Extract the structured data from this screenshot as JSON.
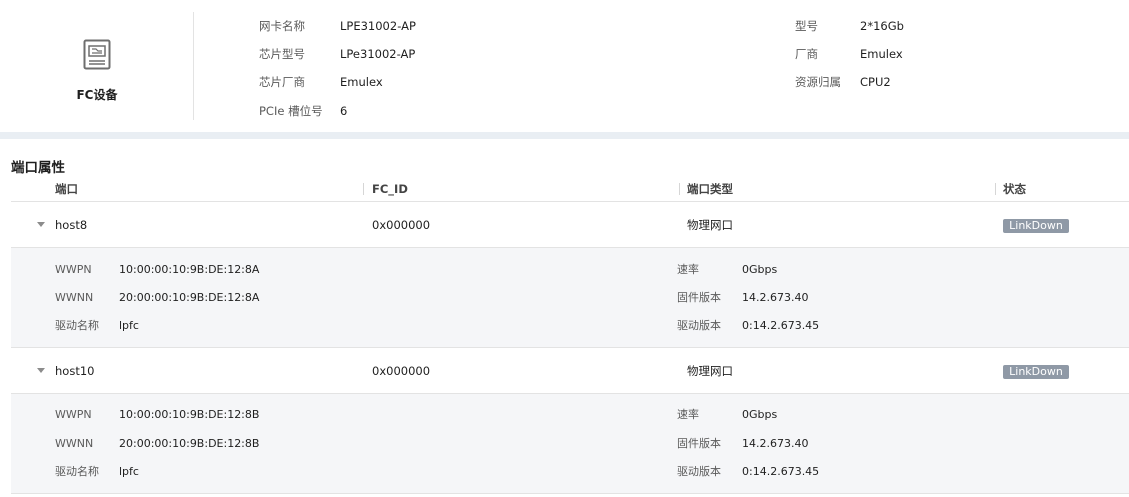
{
  "device": {
    "label": "FC设备",
    "icon": "fc-card-icon",
    "info_left": [
      {
        "label": "网卡名称",
        "value": "LPE31002-AP"
      },
      {
        "label": "芯片型号",
        "value": "LPe31002-AP"
      },
      {
        "label": "芯片厂商",
        "value": "Emulex"
      },
      {
        "label": "PCIe 槽位号",
        "value": "6"
      }
    ],
    "info_right": [
      {
        "label": "型号",
        "value": "2*16Gb"
      },
      {
        "label": "厂商",
        "value": "Emulex"
      },
      {
        "label": "资源归属",
        "value": "CPU2"
      }
    ]
  },
  "ports": {
    "title": "端口属性",
    "columns": [
      "端口",
      "FC_ID",
      "端口类型",
      "状态"
    ],
    "rows": [
      {
        "port": "host8",
        "fc_id": "0x000000",
        "type": "物理网口",
        "status": "LinkDown",
        "details": {
          "wwpn_label": "WWPN",
          "wwpn": "10:00:00:10:9B:DE:12:8A",
          "wwnn_label": "WWNN",
          "wwnn": "20:00:00:10:9B:DE:12:8A",
          "driver_name_label": "驱动名称",
          "driver_name": "lpfc",
          "speed_label": "速率",
          "speed": "0Gbps",
          "firmware_label": "固件版本",
          "firmware": "14.2.673.40",
          "driver_version_label": "驱动版本",
          "driver_version": "0:14.2.673.45"
        }
      },
      {
        "port": "host10",
        "fc_id": "0x000000",
        "type": "物理网口",
        "status": "LinkDown",
        "details": {
          "wwpn_label": "WWPN",
          "wwpn": "10:00:00:10:9B:DE:12:8B",
          "wwnn_label": "WWNN",
          "wwnn": "20:00:00:10:9B:DE:12:8B",
          "driver_name_label": "驱动名称",
          "driver_name": "lpfc",
          "speed_label": "速率",
          "speed": "0Gbps",
          "firmware_label": "固件版本",
          "firmware": "14.2.673.40",
          "driver_version_label": "驱动版本",
          "driver_version": "0:14.2.673.45"
        }
      }
    ]
  },
  "colors": {
    "badge": "#8f99a6",
    "detail_bg": "#f5f6f8",
    "band": "#e9eef3"
  }
}
